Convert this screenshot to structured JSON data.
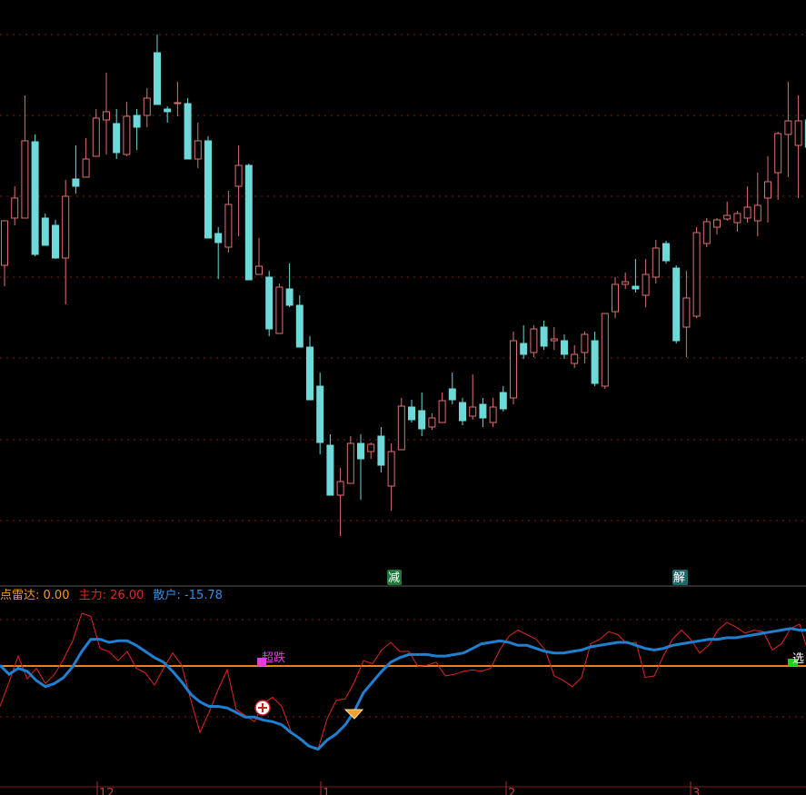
{
  "colors": {
    "background": "#000000",
    "candle_up": "#e07070",
    "candle_down": "#6fd8d8",
    "grid": "#7a1f1f",
    "zhuli": "#e3261c",
    "sanhu": "#1f7fd0",
    "baseline": "#f07f1a",
    "label_orange": "#f59a23",
    "label_red": "#e3261c",
    "label_blue": "#2f8fe0",
    "chaodie": "#e23de0",
    "marker_green_bg": "#1d7a3a"
  },
  "indicator": {
    "name": "点雷达:",
    "value": "0.00",
    "zhuli_label": "主力:",
    "zhuli_value": "26.00",
    "sanhu_label": "散户:",
    "sanhu_value": "-15.78"
  },
  "signals": {
    "jian": "减",
    "jie": "解",
    "chaodie": "超跌",
    "xuan": "选"
  },
  "x_axis_labels": [
    "12",
    "1",
    "2",
    "3"
  ],
  "chart_data": [
    {
      "type": "candlestick",
      "x": [
        1,
        2,
        3,
        4,
        5,
        6,
        7,
        8,
        9,
        10,
        11,
        12,
        13,
        14,
        15,
        16,
        17,
        18,
        19,
        20,
        21,
        22,
        23,
        24,
        25,
        26,
        27,
        28,
        29,
        30,
        31,
        32,
        33,
        34,
        35,
        36,
        37,
        38,
        39,
        40,
        41,
        42,
        43,
        44,
        45,
        46,
        47,
        48,
        49,
        50,
        51,
        52,
        53,
        54,
        55,
        56,
        57,
        58,
        59,
        60,
        61,
        62,
        63,
        64,
        65,
        66,
        67,
        68,
        69,
        70,
        71,
        72,
        73,
        74,
        75,
        76,
        77,
        78,
        79,
        80
      ],
      "series": [
        {
          "name": "K",
          "values": [
            {
              "o": 292,
              "h": 315,
              "l": 243,
              "c": 243,
              "d": false
            },
            {
              "o": 240,
              "h": 205,
              "l": 248,
              "c": 218,
              "d": false
            },
            {
              "o": 240,
              "h": 105,
              "l": 240,
              "c": 155,
              "d": false
            },
            {
              "o": 156,
              "h": 148,
              "l": 282,
              "c": 280,
              "d": true
            },
            {
              "o": 270,
              "h": 235,
              "l": 270,
              "c": 240,
              "d": true
            },
            {
              "o": 248,
              "h": 242,
              "l": 285,
              "c": 284,
              "d": true
            },
            {
              "o": 284,
              "h": 198,
              "l": 335,
              "c": 216,
              "d": false
            },
            {
              "o": 197,
              "h": 160,
              "l": 213,
              "c": 205,
              "d": true
            },
            {
              "o": 195,
              "h": 152,
              "l": 195,
              "c": 175,
              "d": false
            },
            {
              "o": 172,
              "h": 120,
              "l": 172,
              "c": 130,
              "d": false
            },
            {
              "o": 132,
              "h": 80,
              "l": 170,
              "c": 123,
              "d": false
            },
            {
              "o": 136,
              "h": 120,
              "l": 175,
              "c": 168,
              "d": true
            },
            {
              "o": 170,
              "h": 112,
              "l": 172,
              "c": 128,
              "d": false
            },
            {
              "o": 127,
              "h": 120,
              "l": 165,
              "c": 140,
              "d": true
            },
            {
              "o": 127,
              "h": 97,
              "l": 140,
              "c": 108,
              "d": false
            },
            {
              "o": 58,
              "h": 38,
              "l": 115,
              "c": 115,
              "d": true
            },
            {
              "o": 123,
              "h": 117,
              "l": 135,
              "c": 120,
              "d": true
            },
            {
              "o": 113,
              "h": 90,
              "l": 128,
              "c": 113,
              "d": false
            },
            {
              "o": 114,
              "h": 108,
              "l": 175,
              "c": 175,
              "d": true
            },
            {
              "o": 175,
              "h": 135,
              "l": 185,
              "c": 155,
              "d": false
            },
            {
              "o": 155,
              "h": 150,
              "l": 262,
              "c": 262,
              "d": true
            },
            {
              "o": 257,
              "h": 250,
              "l": 307,
              "c": 267,
              "d": true
            },
            {
              "o": 272,
              "h": 210,
              "l": 278,
              "c": 225,
              "d": false
            },
            {
              "o": 205,
              "h": 160,
              "l": 260,
              "c": 182,
              "d": false
            },
            {
              "o": 182,
              "h": 180,
              "l": 308,
              "c": 308,
              "d": true
            },
            {
              "o": 302,
              "h": 262,
              "l": 302,
              "c": 293,
              "d": false
            },
            {
              "o": 305,
              "h": 298,
              "l": 370,
              "c": 362,
              "d": true
            },
            {
              "o": 367,
              "h": 312,
              "l": 367,
              "c": 316,
              "d": false
            },
            {
              "o": 318,
              "h": 290,
              "l": 338,
              "c": 336,
              "d": true
            },
            {
              "o": 336,
              "h": 325,
              "l": 382,
              "c": 382,
              "d": true
            },
            {
              "o": 382,
              "h": 370,
              "l": 440,
              "c": 440,
              "d": true
            },
            {
              "o": 425,
              "h": 410,
              "l": 500,
              "c": 487,
              "d": true
            },
            {
              "o": 490,
              "h": 478,
              "l": 545,
              "c": 545,
              "d": true
            },
            {
              "o": 545,
              "h": 515,
              "l": 590,
              "c": 530,
              "d": false
            },
            {
              "o": 532,
              "h": 480,
              "l": 532,
              "c": 488,
              "d": false
            },
            {
              "o": 488,
              "h": 478,
              "l": 550,
              "c": 505,
              "d": true
            },
            {
              "o": 497,
              "h": 487,
              "l": 505,
              "c": 489,
              "d": false
            },
            {
              "o": 480,
              "h": 470,
              "l": 520,
              "c": 512,
              "d": true
            },
            {
              "o": 535,
              "h": 488,
              "l": 562,
              "c": 497,
              "d": false
            },
            {
              "o": 495,
              "h": 438,
              "l": 495,
              "c": 447,
              "d": false
            },
            {
              "o": 448,
              "h": 440,
              "l": 465,
              "c": 462,
              "d": true
            },
            {
              "o": 452,
              "h": 432,
              "l": 480,
              "c": 472,
              "d": true
            },
            {
              "o": 470,
              "h": 455,
              "l": 473,
              "c": 460,
              "d": false
            },
            {
              "o": 465,
              "h": 432,
              "l": 465,
              "c": 441,
              "d": false
            },
            {
              "o": 428,
              "h": 410,
              "l": 445,
              "c": 440,
              "d": true
            },
            {
              "o": 443,
              "h": 438,
              "l": 468,
              "c": 463,
              "d": true
            },
            {
              "o": 458,
              "h": 412,
              "l": 462,
              "c": 448,
              "d": false
            },
            {
              "o": 445,
              "h": 438,
              "l": 470,
              "c": 460,
              "d": true
            },
            {
              "o": 465,
              "h": 438,
              "l": 470,
              "c": 448,
              "d": false
            },
            {
              "o": 432,
              "h": 425,
              "l": 453,
              "c": 450,
              "d": true
            },
            {
              "o": 438,
              "h": 365,
              "l": 445,
              "c": 375,
              "d": false
            },
            {
              "o": 378,
              "h": 358,
              "l": 395,
              "c": 390,
              "d": true
            },
            {
              "o": 388,
              "h": 358,
              "l": 393,
              "c": 362,
              "d": false
            },
            {
              "o": 360,
              "h": 353,
              "l": 385,
              "c": 381,
              "d": true
            },
            {
              "o": 373,
              "h": 360,
              "l": 385,
              "c": 375,
              "d": false
            },
            {
              "o": 375,
              "h": 368,
              "l": 395,
              "c": 390,
              "d": true
            },
            {
              "o": 400,
              "h": 380,
              "l": 405,
              "c": 390,
              "d": false
            },
            {
              "o": 388,
              "h": 365,
              "l": 400,
              "c": 368,
              "d": false
            },
            {
              "o": 375,
              "h": 365,
              "l": 425,
              "c": 422,
              "d": true
            },
            {
              "o": 425,
              "h": 348,
              "l": 428,
              "c": 345,
              "d": false
            },
            {
              "o": 343,
              "h": 305,
              "l": 350,
              "c": 313,
              "d": false
            },
            {
              "o": 313,
              "h": 300,
              "l": 318,
              "c": 310,
              "d": false
            },
            {
              "o": 315,
              "h": 285,
              "l": 322,
              "c": 318,
              "d": true
            },
            {
              "o": 325,
              "h": 285,
              "l": 338,
              "c": 302,
              "d": false
            },
            {
              "o": 305,
              "h": 264,
              "l": 312,
              "c": 273,
              "d": false
            },
            {
              "o": 268,
              "h": 265,
              "l": 290,
              "c": 287,
              "d": true
            },
            {
              "o": 295,
              "h": 292,
              "l": 378,
              "c": 375,
              "d": true
            },
            {
              "o": 360,
              "h": 298,
              "l": 393,
              "c": 328,
              "d": false
            },
            {
              "o": 348,
              "h": 250,
              "l": 350,
              "c": 256,
              "d": false
            },
            {
              "o": 268,
              "h": 240,
              "l": 272,
              "c": 244,
              "d": false
            },
            {
              "o": 250,
              "h": 240,
              "l": 258,
              "c": 242,
              "d": false
            },
            {
              "o": 241,
              "h": 222,
              "l": 243,
              "c": 237,
              "d": false
            },
            {
              "o": 245,
              "h": 232,
              "l": 255,
              "c": 235,
              "d": false
            },
            {
              "o": 240,
              "h": 205,
              "l": 245,
              "c": 228,
              "d": false
            },
            {
              "o": 243,
              "h": 190,
              "l": 260,
              "c": 226,
              "d": false
            },
            {
              "o": 218,
              "h": 172,
              "l": 245,
              "c": 200,
              "d": false
            },
            {
              "o": 190,
              "h": 145,
              "l": 220,
              "c": 147,
              "d": false
            },
            {
              "o": 148,
              "h": 90,
              "l": 195,
              "c": 133,
              "d": false
            },
            {
              "o": 133,
              "h": 105,
              "l": 218,
              "c": 160,
              "d": false
            },
            {
              "o": 132,
              "h": 120,
              "l": 165,
              "c": 162,
              "d": true
            }
          ]
        }
      ],
      "note_price_scale": "values are price axis units (no price labels printed)"
    },
    {
      "type": "line",
      "x": [
        0,
        10,
        20,
        30,
        40,
        50,
        60,
        70,
        80,
        90,
        100,
        110,
        120,
        130,
        140,
        150,
        160,
        170,
        180,
        190,
        200,
        210,
        220,
        230,
        240,
        250,
        260,
        270,
        280,
        290,
        300,
        310,
        320,
        330,
        340,
        350,
        360,
        370,
        380,
        390,
        400,
        410,
        420,
        430,
        440,
        450,
        460,
        470,
        480,
        490,
        500,
        510,
        520,
        530,
        540,
        550,
        560,
        570,
        580,
        590,
        600,
        610,
        620,
        630,
        640,
        650,
        660,
        670,
        680,
        690,
        700,
        710,
        720,
        730,
        740,
        750,
        760,
        770,
        780,
        790,
        800,
        810,
        820,
        830,
        840,
        850,
        860,
        870,
        880,
        887
      ],
      "ylim": [
        0,
        100
      ],
      "series": [
        {
          "name": "主力",
          "values": [
            36,
            52,
            69,
            54,
            61,
            51,
            57,
            67,
            79,
            97,
            95,
            74,
            72,
            66,
            72,
            61,
            58,
            50,
            61,
            71,
            63,
            40,
            19,
            32,
            47,
            60,
            34,
            30,
            26,
            38,
            42,
            36,
            20,
            14,
            10,
            8,
            28,
            40,
            41,
            52,
            66,
            64,
            73,
            78,
            72,
            72,
            62,
            63,
            65,
            56,
            57,
            59,
            60,
            59,
            61,
            73,
            82,
            86,
            83,
            80,
            73,
            56,
            53,
            49,
            55,
            77,
            80,
            85,
            83,
            77,
            78,
            55,
            56,
            69,
            80,
            86,
            80,
            71,
            76,
            86,
            91,
            88,
            84,
            86,
            85,
            73,
            77,
            87,
            90,
            76
          ]
        },
        {
          "name": "散户",
          "values": [
            63,
            57,
            61,
            59,
            53,
            49,
            51,
            55,
            62,
            72,
            80,
            80,
            78,
            79,
            79,
            76,
            72,
            68,
            65,
            59,
            52,
            44,
            39,
            36,
            36,
            35,
            32,
            29,
            29,
            27,
            26,
            24,
            19,
            15,
            10,
            8,
            14,
            18,
            24,
            33,
            45,
            52,
            59,
            65,
            68,
            70,
            70,
            70,
            69,
            69,
            70,
            71,
            74,
            77,
            78,
            79,
            78,
            76,
            76,
            74,
            72,
            71,
            71,
            72,
            73,
            75,
            76,
            77,
            78,
            78,
            76,
            74,
            73,
            74,
            76,
            77,
            78,
            79,
            80,
            80,
            81,
            81,
            82,
            83,
            84,
            85,
            86,
            87,
            86,
            86
          ]
        }
      ],
      "reference_line": 50
    }
  ]
}
